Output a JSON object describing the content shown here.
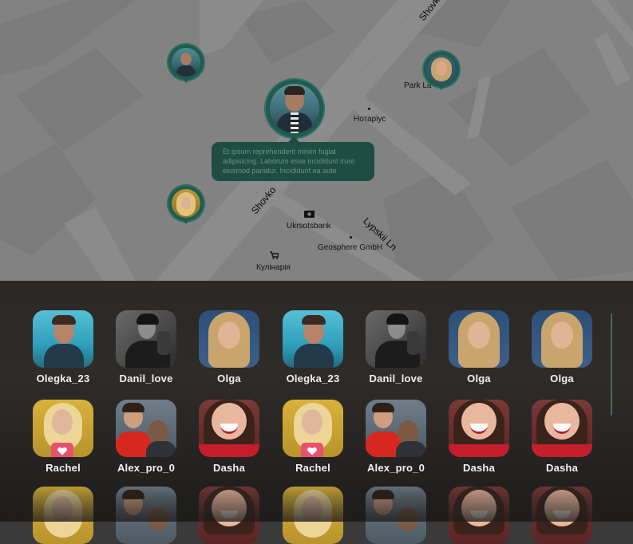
{
  "map": {
    "streets": [
      {
        "id": "shovko-top",
        "label": "Shovko"
      },
      {
        "id": "shovko-mid",
        "label": "Shovko"
      },
      {
        "id": "lypskii",
        "label": "Lypskii Ln"
      }
    ],
    "pois": [
      {
        "id": "park",
        "label": "Park La"
      },
      {
        "id": "notarius",
        "label": "Нотаріус"
      },
      {
        "id": "ukrsotsbank",
        "label": "Ukrsotsbank",
        "icon": "bank-icon"
      },
      {
        "id": "geosphere",
        "label": "Geosphere GmbH"
      },
      {
        "id": "kulinaria",
        "label": "Кулінарія",
        "icon": "shopping-cart-icon"
      }
    ],
    "message": "Et ipsum reprehenderit minim fugiat adipisicing. Laborum esse incididunt irure eiusmod pariatur. Incididunt ea aute",
    "accent_color": "#1f5b4f"
  },
  "users": {
    "row1": [
      {
        "name": "Olegka_23",
        "avatar": "teal-man-icon"
      },
      {
        "name": "Danil_love",
        "avatar": "bw-man-icon"
      },
      {
        "name": "Olga",
        "avatar": "blonde-woman-icon"
      },
      {
        "name": "Olegka_23",
        "avatar": "teal-man-icon"
      },
      {
        "name": "Danil_love",
        "avatar": "bw-man-icon"
      },
      {
        "name": "Olga",
        "avatar": "blonde-woman-icon"
      },
      {
        "name": "Olga",
        "avatar": "blonde-woman-icon"
      }
    ],
    "row2": [
      {
        "name": "Rachel",
        "avatar": "yellow-woman-icon",
        "favorite": true
      },
      {
        "name": "Alex_pro_0",
        "avatar": "couple-icon"
      },
      {
        "name": "Dasha",
        "avatar": "smiling-woman-icon"
      },
      {
        "name": "Rachel",
        "avatar": "yellow-woman-icon",
        "favorite": true
      },
      {
        "name": "Alex_pro_0",
        "avatar": "couple-icon"
      },
      {
        "name": "Dasha",
        "avatar": "smiling-woman-icon"
      },
      {
        "name": "Dasha",
        "avatar": "smiling-woman-icon"
      }
    ]
  }
}
